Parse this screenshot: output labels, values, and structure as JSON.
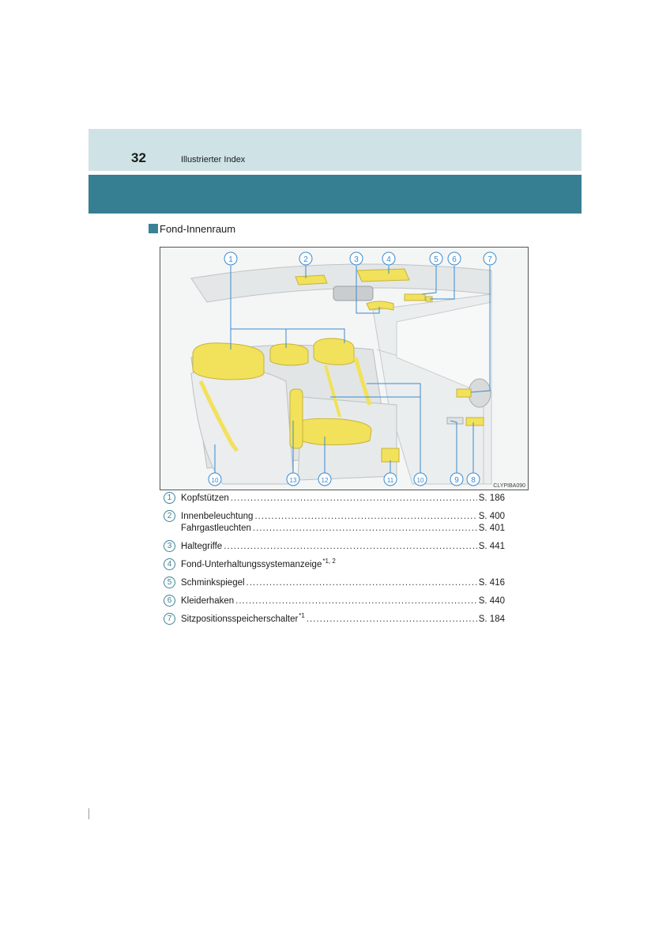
{
  "header": {
    "page_number": "32",
    "title": "Illustrierter Index"
  },
  "section": {
    "title": "Fond-Innenraum"
  },
  "figure": {
    "code": "CLYPIBA090",
    "callouts": [
      "①",
      "②",
      "③",
      "④",
      "⑤",
      "⑥",
      "⑦",
      "⑧",
      "⑨",
      "⑩",
      "⑪",
      "⑫",
      "⑬"
    ]
  },
  "items": [
    {
      "num": "1",
      "label": "Kopfstützen",
      "sup": "",
      "page": "S. 186"
    },
    {
      "num": "2",
      "label": "Innenbeleuchtung",
      "sup": "",
      "page": "S. 400"
    },
    {
      "num": "",
      "label": "Fahrgastleuchten",
      "sup": "",
      "page": "S. 401"
    },
    {
      "num": "3",
      "label": "Haltegriffe",
      "sup": "",
      "page": "S. 441"
    },
    {
      "num": "4",
      "label": "Fond-Unterhaltungssystemanzeige",
      "sup": "*1, 2",
      "page": ""
    },
    {
      "num": "5",
      "label": "Schminkspiegel",
      "sup": "",
      "page": "S. 416"
    },
    {
      "num": "6",
      "label": "Kleiderhaken",
      "sup": "",
      "page": "S. 440"
    },
    {
      "num": "7",
      "label": "Sitzpositionsspeicherschalter",
      "sup": "*1",
      "page": "S. 184"
    }
  ],
  "colors": {
    "accent_dark": "#367e92",
    "accent_light": "#cfe3e6",
    "highlight": "#f2e15a"
  }
}
